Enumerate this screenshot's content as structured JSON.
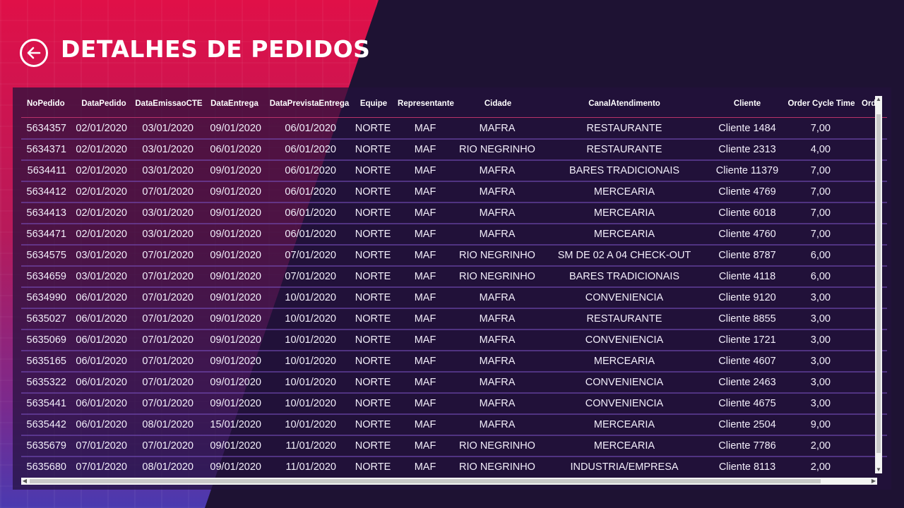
{
  "header": {
    "title": "DETALHES DE PEDIDOS",
    "back_icon": "arrow-left-circle-icon"
  },
  "table": {
    "columns": [
      "NoPedido",
      "DataPedido",
      "DataEmissaoCTE",
      "DataEntrega",
      "DataPrevistaEntrega",
      "Equipe",
      "Representante",
      "Cidade",
      "CanalAtendimento",
      "Cliente",
      "Order Cycle Time",
      "Ord"
    ],
    "rows": [
      [
        "5634357",
        "02/01/2020",
        "03/01/2020",
        "09/01/2020",
        "06/01/2020",
        "NORTE",
        "MAF",
        "MAFRA",
        "RESTAURANTE",
        "Cliente 1484",
        "7,00"
      ],
      [
        "5634371",
        "02/01/2020",
        "03/01/2020",
        "06/01/2020",
        "06/01/2020",
        "NORTE",
        "MAF",
        "RIO NEGRINHO",
        "RESTAURANTE",
        "Cliente 2313",
        "4,00"
      ],
      [
        "5634411",
        "02/01/2020",
        "03/01/2020",
        "09/01/2020",
        "06/01/2020",
        "NORTE",
        "MAF",
        "MAFRA",
        "BARES TRADICIONAIS",
        "Cliente 11379",
        "7,00"
      ],
      [
        "5634412",
        "02/01/2020",
        "07/01/2020",
        "09/01/2020",
        "06/01/2020",
        "NORTE",
        "MAF",
        "MAFRA",
        "MERCEARIA",
        "Cliente 4769",
        "7,00"
      ],
      [
        "5634413",
        "02/01/2020",
        "03/01/2020",
        "09/01/2020",
        "06/01/2020",
        "NORTE",
        "MAF",
        "MAFRA",
        "MERCEARIA",
        "Cliente 6018",
        "7,00"
      ],
      [
        "5634471",
        "02/01/2020",
        "03/01/2020",
        "09/01/2020",
        "06/01/2020",
        "NORTE",
        "MAF",
        "MAFRA",
        "MERCEARIA",
        "Cliente 4760",
        "7,00"
      ],
      [
        "5634575",
        "03/01/2020",
        "07/01/2020",
        "09/01/2020",
        "07/01/2020",
        "NORTE",
        "MAF",
        "RIO NEGRINHO",
        "SM DE 02 A 04 CHECK-OUT",
        "Cliente 8787",
        "6,00"
      ],
      [
        "5634659",
        "03/01/2020",
        "07/01/2020",
        "09/01/2020",
        "07/01/2020",
        "NORTE",
        "MAF",
        "RIO NEGRINHO",
        "BARES TRADICIONAIS",
        "Cliente 4118",
        "6,00"
      ],
      [
        "5634990",
        "06/01/2020",
        "07/01/2020",
        "09/01/2020",
        "10/01/2020",
        "NORTE",
        "MAF",
        "MAFRA",
        "CONVENIENCIA",
        "Cliente 9120",
        "3,00"
      ],
      [
        "5635027",
        "06/01/2020",
        "07/01/2020",
        "09/01/2020",
        "10/01/2020",
        "NORTE",
        "MAF",
        "MAFRA",
        "RESTAURANTE",
        "Cliente 8855",
        "3,00"
      ],
      [
        "5635069",
        "06/01/2020",
        "07/01/2020",
        "09/01/2020",
        "10/01/2020",
        "NORTE",
        "MAF",
        "MAFRA",
        "CONVENIENCIA",
        "Cliente 1721",
        "3,00"
      ],
      [
        "5635165",
        "06/01/2020",
        "07/01/2020",
        "09/01/2020",
        "10/01/2020",
        "NORTE",
        "MAF",
        "MAFRA",
        "MERCEARIA",
        "Cliente 4607",
        "3,00"
      ],
      [
        "5635322",
        "06/01/2020",
        "07/01/2020",
        "09/01/2020",
        "10/01/2020",
        "NORTE",
        "MAF",
        "MAFRA",
        "CONVENIENCIA",
        "Cliente 2463",
        "3,00"
      ],
      [
        "5635441",
        "06/01/2020",
        "07/01/2020",
        "09/01/2020",
        "10/01/2020",
        "NORTE",
        "MAF",
        "MAFRA",
        "CONVENIENCIA",
        "Cliente 4675",
        "3,00"
      ],
      [
        "5635442",
        "06/01/2020",
        "08/01/2020",
        "15/01/2020",
        "10/01/2020",
        "NORTE",
        "MAF",
        "MAFRA",
        "MERCEARIA",
        "Cliente 2504",
        "9,00"
      ],
      [
        "5635679",
        "07/01/2020",
        "07/01/2020",
        "09/01/2020",
        "11/01/2020",
        "NORTE",
        "MAF",
        "RIO NEGRINHO",
        "MERCEARIA",
        "Cliente 7786",
        "2,00"
      ],
      [
        "5635680",
        "07/01/2020",
        "08/01/2020",
        "09/01/2020",
        "11/01/2020",
        "NORTE",
        "MAF",
        "RIO NEGRINHO",
        "INDUSTRIA/EMPRESA",
        "Cliente 8113",
        "2,00"
      ]
    ]
  },
  "scrollbars": {
    "up_icon": "chevron-up-icon",
    "down_icon": "chevron-down-icon",
    "left_icon": "chevron-left-icon",
    "right_icon": "chevron-right-icon"
  }
}
